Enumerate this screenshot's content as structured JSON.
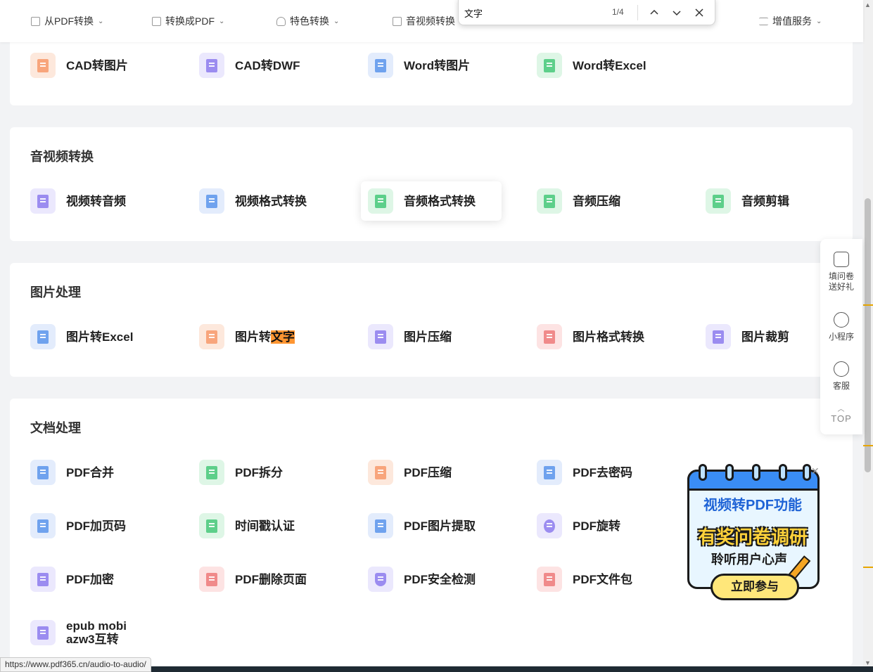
{
  "nav": {
    "items": [
      "从PDF转换",
      "转换成PDF",
      "特色转换",
      "音视频转换",
      "增值服务"
    ]
  },
  "findbar": {
    "query": "文字",
    "count": "1/4",
    "prev_icon": "chevron-up-icon",
    "next_icon": "chevron-down-icon",
    "close_icon": "close-icon"
  },
  "sections": {
    "cad": {
      "tools": [
        "CAD转图片",
        "CAD转DWF",
        "Word转图片",
        "Word转Excel"
      ]
    },
    "av": {
      "title": "音视频转换",
      "tools": [
        "视频转音频",
        "视频格式转换",
        "音频格式转换",
        "音频压缩",
        "音频剪辑"
      ]
    },
    "img": {
      "title": "图片处理",
      "tools": [
        "图片转Excel",
        "图片转",
        "图片压缩",
        "图片格式转换",
        "图片裁剪"
      ],
      "highlight": "文字"
    },
    "doc": {
      "title": "文档处理",
      "tools": [
        "PDF合并",
        "PDF拆分",
        "PDF压缩",
        "PDF去密码",
        "PDF加页码",
        "时间戳认证",
        "PDF图片提取",
        "PDF旋转",
        "PDF加密",
        "PDF删除页面",
        "PDF安全检测",
        "PDF文件包",
        "epub mobi azw3互转"
      ]
    }
  },
  "sidebar": {
    "survey": "填问卷送好礼",
    "miniprogram": "小程序",
    "service": "客服",
    "top": "TOP"
  },
  "promo": {
    "line1": "视频转PDF功能",
    "line2": "有奖问卷调研",
    "line3": "聆听用户心声",
    "button": "立即参与"
  },
  "status_url": "https://www.pdf365.cn/audio-to-audio/",
  "colors": {
    "orange": "#f8a57c",
    "purple": "#9b8cf0",
    "blue": "#6fa2ee",
    "green": "#5dcf8a",
    "red": "#f08a8a",
    "find_highlight": "#ff9632"
  }
}
